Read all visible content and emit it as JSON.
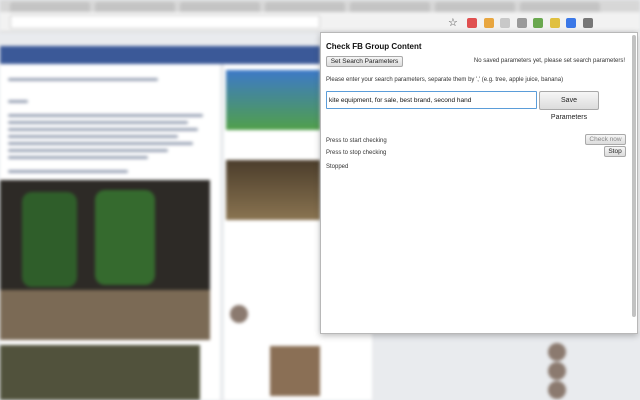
{
  "popup": {
    "title": "Check FB Group Content",
    "set_button": "Set Search Parameters",
    "no_saved_msg": "No saved parameters yet, please set search parameters!",
    "instructions": "Please enter your search parameters, separate them by ',' (e.g. tree, apple juice, banana)",
    "search_value": "kite equipment, for sale, best brand, second hand",
    "save_button": "Save Parameters",
    "start_label": "Press to start checking",
    "check_button": "Check now",
    "stop_label": "Press to stop checking",
    "stop_button": "Stop",
    "status": "Stopped"
  },
  "toolbar": {
    "star_icon": "bookmark-star-icon",
    "extension_colors": [
      "#e05050",
      "#e8a640",
      "#c8c8c8",
      "#9a9a9a",
      "#6aa84f",
      "#e0c040",
      "#3b78e7",
      "#777777"
    ]
  },
  "colors": {
    "facebook_blue": "#3b5998",
    "input_focus": "#5b9dd9"
  }
}
